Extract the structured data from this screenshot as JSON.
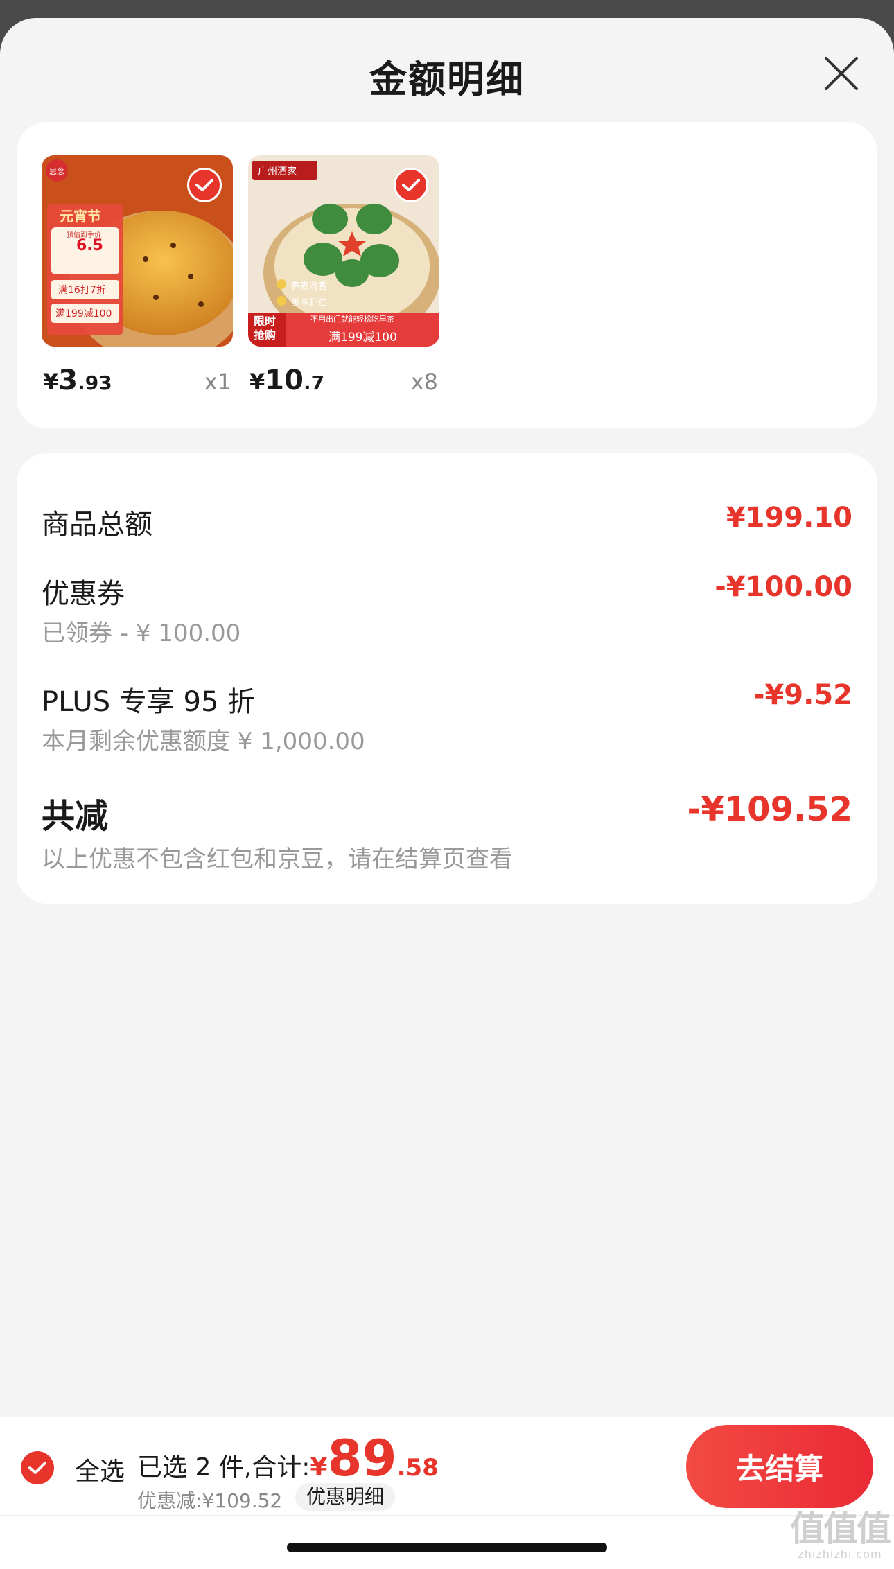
{
  "sheet": {
    "title": "金额明细"
  },
  "products": [
    {
      "price_currency": "¥",
      "price_int": "3",
      "price_dec": ".93",
      "quantity": "x1",
      "image": {
        "brand": "思念",
        "festival": "元宵节",
        "promo_small": "预估到手价",
        "price": "6.5",
        "line1": "满16打7折",
        "line2": "满199减100"
      }
    },
    {
      "price_currency": "¥",
      "price_int": "10",
      "price_dec": ".7",
      "quantity": "x8",
      "image": {
        "brand": "广州酒家",
        "feature1": "荞麦清香",
        "feature2": "美味虾仁",
        "tag": "限时抢购",
        "banner_small": "不用出门就能轻松吃早茶",
        "banner": "满199减100"
      }
    }
  ],
  "details": {
    "goods_total_label": "商品总额",
    "goods_total_value": "¥199.10",
    "coupon_label": "优惠券",
    "coupon_sub": "已领券 - ¥ 100.00",
    "coupon_value": "-¥100.00",
    "plus_label": "PLUS 专享 95 折",
    "plus_sub": "本月剩余优惠额度 ¥ 1,000.00",
    "plus_value": "-¥9.52",
    "total_label": "共减",
    "total_value": "-¥109.52",
    "total_note": "以上优惠不包含红包和京豆，请在结算页查看"
  },
  "bottom": {
    "select_all": "全选",
    "selected_text": "已选 2 件,合计:",
    "sum_currency": "¥",
    "sum_int": "89",
    "sum_dec": ".58",
    "discount_text": "优惠减:¥109.52",
    "detail_link": "优惠明细",
    "checkout": "去结算"
  },
  "watermark": {
    "logo": "值值值",
    "domain": "zhizhizhi.com"
  },
  "colors": {
    "accent": "#e8352b",
    "sheet_bg": "#f4f4f4",
    "card_bg": "#ffffff"
  }
}
